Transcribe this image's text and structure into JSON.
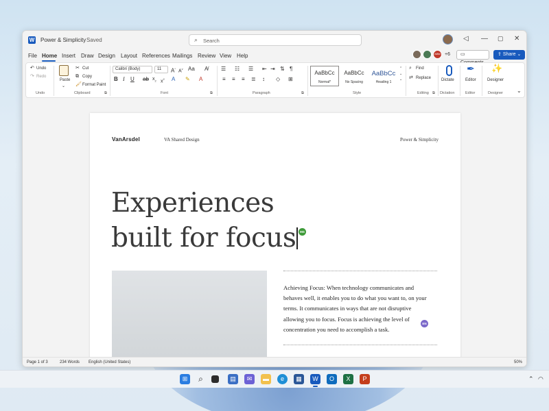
{
  "window": {
    "app_icon": "word-icon",
    "title": "Power & Simplicity",
    "save_status": "Saved",
    "search_placeholder": "Search"
  },
  "menu_tabs": [
    "File",
    "Home",
    "Insert",
    "Draw",
    "Design",
    "Layout",
    "References",
    "Mailings",
    "Review",
    "View",
    "Help"
  ],
  "active_tab": "Home",
  "collaborators": {
    "initials": [
      "",
      "",
      "ABM"
    ],
    "overflow_count": "+6"
  },
  "actions": {
    "comments": "Comments",
    "share": "Share"
  },
  "ribbon": {
    "undo": {
      "undo": "Undo",
      "redo": "Redo",
      "label": "Undo"
    },
    "clipboard": {
      "paste": "Paste",
      "cut": "Cut",
      "copy": "Copy",
      "format_painter": "Format Paint",
      "label": "Clipboard"
    },
    "font": {
      "family": "Calibri (Body)",
      "size": "11",
      "label": "Font"
    },
    "paragraph": {
      "label": "Paragraph"
    },
    "styles": {
      "items": [
        {
          "preview": "AaBbCc",
          "name": "Normal*"
        },
        {
          "preview": "AaBbCc",
          "name": "No Spacing"
        },
        {
          "preview": "AaBbCc",
          "name": "Heading 1"
        }
      ],
      "label": "Style"
    },
    "editing": {
      "find": "Find",
      "replace": "Replace",
      "label": "Editing"
    },
    "dictation": {
      "button": "Dictate",
      "label": "Dictation"
    },
    "editor": {
      "button": "Editor",
      "label": "Editor"
    },
    "designer": {
      "button": "Designer",
      "label": "Designer"
    }
  },
  "document": {
    "header_logo": "VanArsdel",
    "header_center": "VA Shared Design",
    "header_right": "Power & Simplicity",
    "headline_line1": "Experiences",
    "headline_line2": "built for focus",
    "presence_1": "MS",
    "presence_2": "EN",
    "body_paragraph": "Achieving Focus: When technology communicates and behaves well, it enables you to do what you want to, on your terms. It communicates in ways that are not disruptive allowing you to focus. Focus is achieving the level of concentration you need to accomplish a task."
  },
  "status_bar": {
    "page": "Page 1 of 3",
    "words": "234 Words",
    "language": "English (United States)",
    "zoom": "50%"
  },
  "taskbar_icons": [
    "windows-start-icon",
    "search-icon",
    "task-view-icon",
    "widgets-icon",
    "chat-icon",
    "file-explorer-icon",
    "edge-icon",
    "store-icon",
    "word-icon",
    "outlook-icon",
    "excel-icon",
    "powerpoint-icon"
  ],
  "colors": {
    "accent": "#185abd",
    "ribbon_bg": "#ffffff",
    "canvas": "#f3f3f3"
  }
}
